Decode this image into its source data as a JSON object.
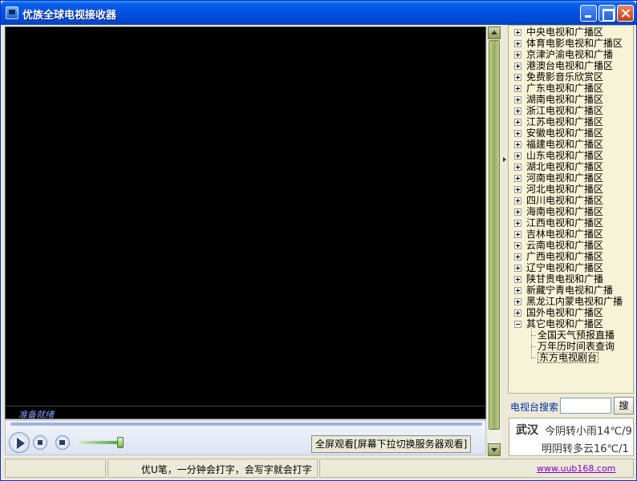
{
  "window": {
    "title": "优族全球电视接收器"
  },
  "player": {
    "status": "准备就绪",
    "volume_percent": 95,
    "fullscreen_hint": "全屏观看[屏幕下拉切换服务器观看]"
  },
  "tree": {
    "groups": [
      "中央电视和广播区",
      "体育电影电视和广播区",
      "京津沪渝电视和广播",
      "港澳台电视和广播区",
      "免费影音乐欣赏区",
      "广东电视和广播区",
      "湖南电视和广播区",
      "浙江电视和广播区",
      "江苏电视和广播区",
      "安徽电视和广播区",
      "福建电视和广播区",
      "山东电视和广播区",
      "湖北电视和广播区",
      "河南电视和广播区",
      "河北电视和广播区",
      "四川电视和广播区",
      "海南电视和广播区",
      "江西电视和广播区",
      "吉林电视和广播区",
      "云南电视和广播区",
      "广西电视和广播区",
      "辽宁电视和广播区",
      "陕甘贵电视和广播",
      "新藏宁青电视和广播",
      "黑龙江内蒙电视和广播",
      "国外电视和广播区",
      "其它电视和广播区"
    ],
    "expanded_children": [
      "全国天气预报直播",
      "万年历时间表查询",
      "东方电视剧台"
    ]
  },
  "search": {
    "label": "电视台搜索",
    "value": "",
    "button": "搜"
  },
  "weather": {
    "city": "武汉",
    "today": "今阴转小雨14℃/9",
    "tomorrow": "明阴转多云16℃/1"
  },
  "statusbar": {
    "ad_text": "优U笔，一分钟会打字，会写字就会打字",
    "link": "www.uub168.com"
  }
}
